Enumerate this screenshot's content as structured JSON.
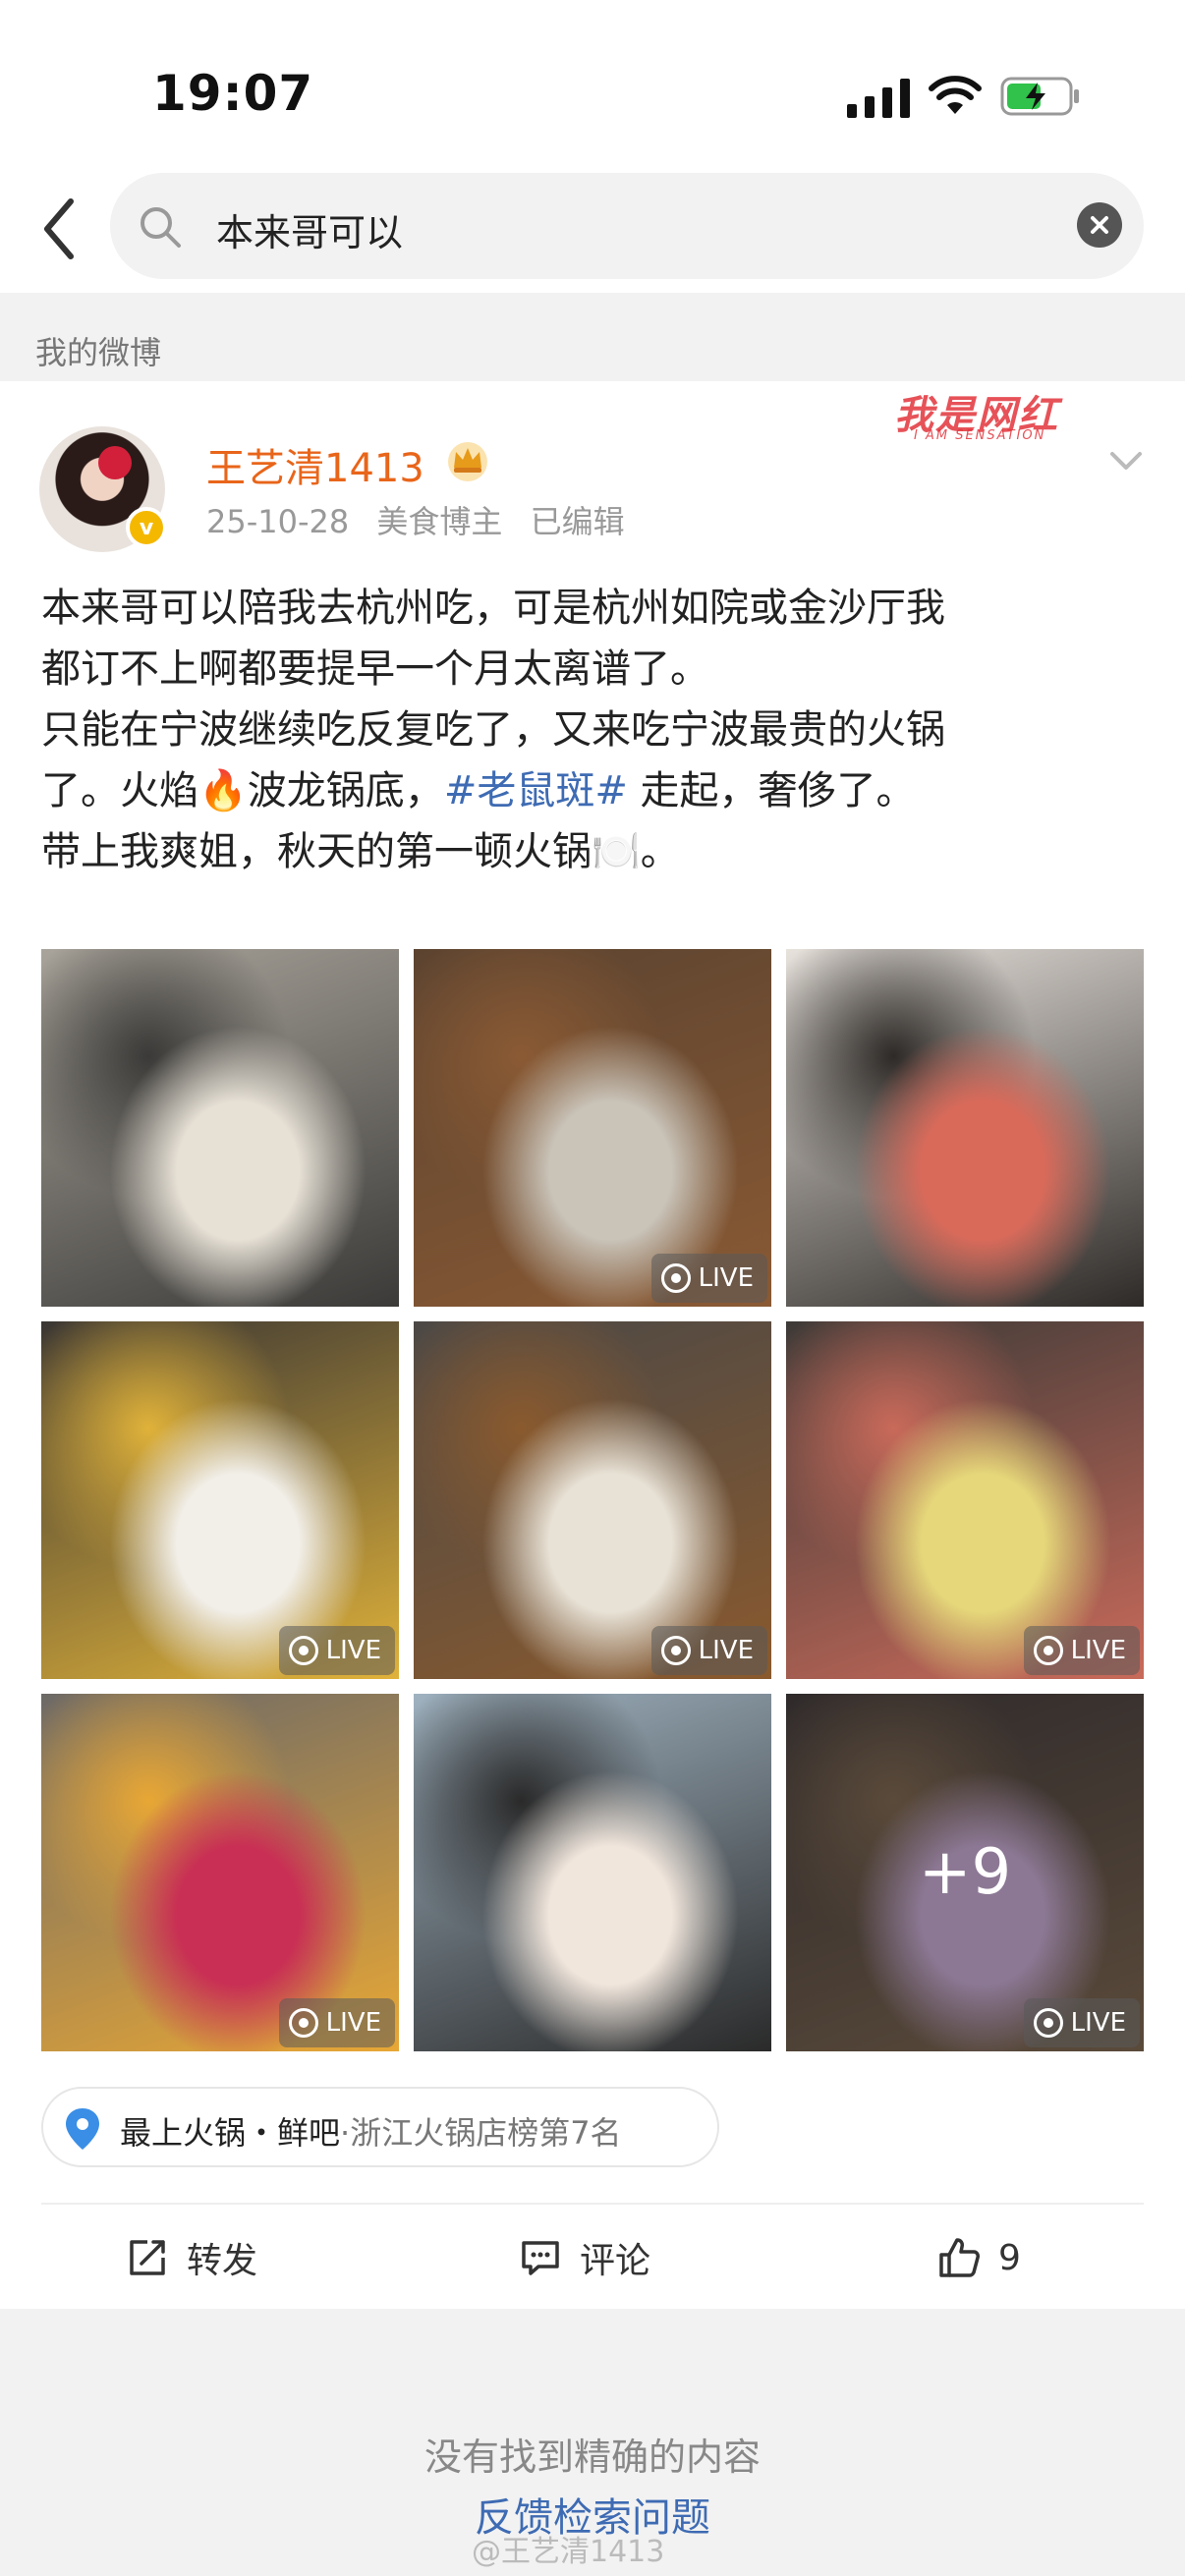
{
  "status_bar": {
    "time": "19:07"
  },
  "search": {
    "query": "本来哥可以"
  },
  "section": {
    "title": "我的微博"
  },
  "post": {
    "author": "王艺清1413",
    "date": "25-10-28",
    "role": "美食博主",
    "edited": "已编辑",
    "brand_mark": "我是网红",
    "brand_sub": "I AM SENSATION",
    "text_lines": [
      "本来哥可以陪我去杭州吃，可是杭州如院或金沙厅我",
      "都订不上啊都要提早一个月太离谱了。",
      "只能在宁波继续吃反复吃了，又来吃宁波最贵的火锅",
      "了。火焰🔥波龙锅底，",
      "#老鼠斑#",
      " 走起，奢侈了。",
      "带上我爽姐，秋天的第一顿火锅🍽️。"
    ],
    "photos": [
      {
        "live": false,
        "colors": [
          "#a9a49b",
          "#e6e0d5",
          "#3b3a38"
        ]
      },
      {
        "live": true,
        "colors": [
          "#5b4330",
          "#c9c3b8",
          "#8a5a34"
        ]
      },
      {
        "live": false,
        "colors": [
          "#e7e2dc",
          "#d96a5a",
          "#2e2a27"
        ]
      },
      {
        "live": true,
        "colors": [
          "#3a3633",
          "#f2efe9",
          "#e0b23a"
        ]
      },
      {
        "live": true,
        "colors": [
          "#4b4846",
          "#e8e2d6",
          "#8a5a2e"
        ]
      },
      {
        "live": true,
        "colors": [
          "#3d3a37",
          "#e6d77a",
          "#c96a5a"
        ]
      },
      {
        "live": true,
        "colors": [
          "#6c6967",
          "#c92f54",
          "#e8a735"
        ]
      },
      {
        "live": false,
        "colors": [
          "#9fb2c0",
          "#f1e6dc",
          "#2a2a2a"
        ]
      },
      {
        "live": true,
        "colors": [
          "#2f2a2b",
          "#8c7894",
          "#5a4a3a"
        ]
      }
    ],
    "live_label": "LIVE",
    "more_count": "+9",
    "location_name": "最上火锅・鲜吧",
    "location_rank": "·浙江火锅店榜第7名",
    "repost_label": "转发",
    "comment_label": "评论",
    "like_count": "9"
  },
  "bottom": {
    "no_exact": "没有找到精确的内容",
    "feedback": "反馈检索问题",
    "watermark": "@王艺清1413"
  },
  "colors": {
    "username": "#e8651a",
    "hashtag": "#3e6bb3",
    "link": "#3e6bb3",
    "verified": "#f5b800"
  }
}
